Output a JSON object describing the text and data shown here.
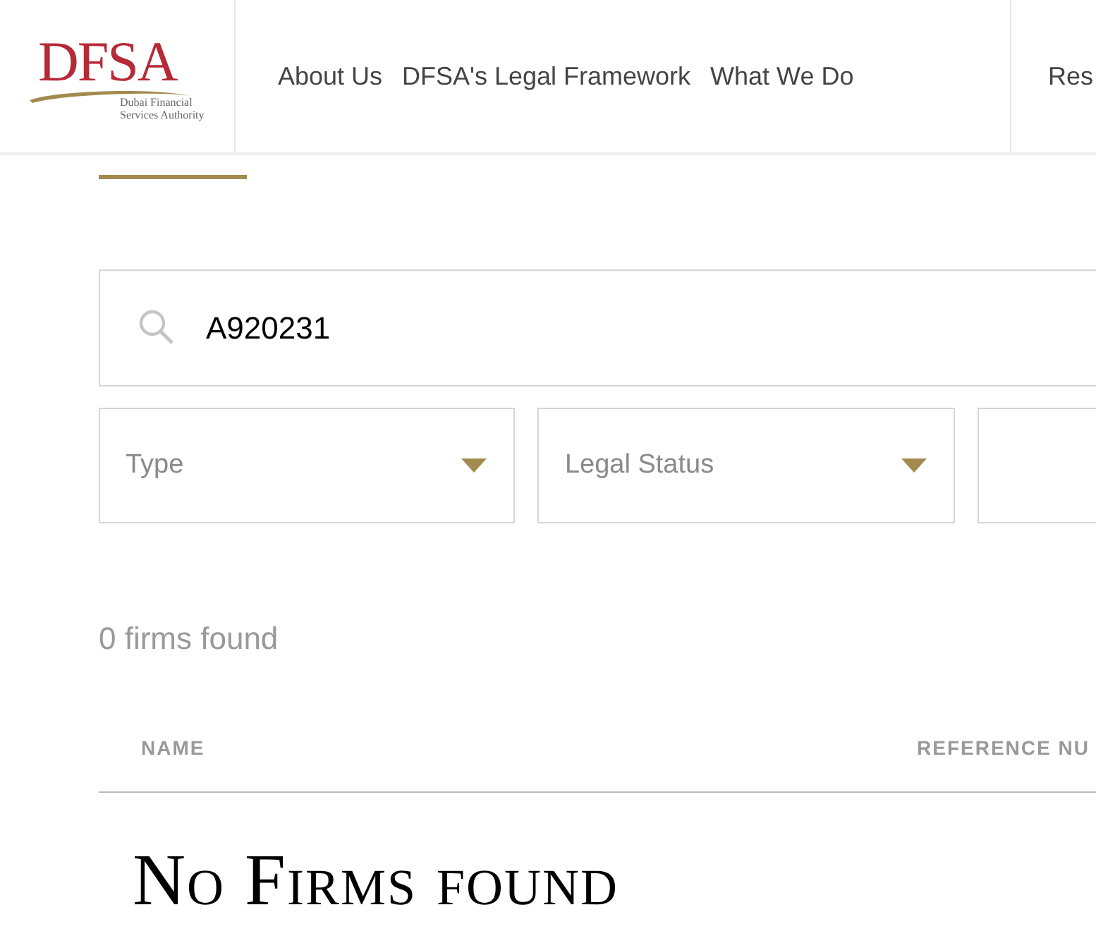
{
  "logo": {
    "mark": "DFSA",
    "tagline": "Dubai Financial Services Authority"
  },
  "nav": [
    "About Us",
    "DFSA's Legal Framework",
    "What We Do",
    "Res"
  ],
  "search": {
    "value": "A920231"
  },
  "filters": [
    {
      "placeholder": "Type"
    },
    {
      "placeholder": "Legal Status"
    }
  ],
  "results_count": "0 firms found",
  "table": {
    "columns": [
      "NAME",
      "REFERENCE NU"
    ]
  },
  "empty_message": "No Firms found"
}
